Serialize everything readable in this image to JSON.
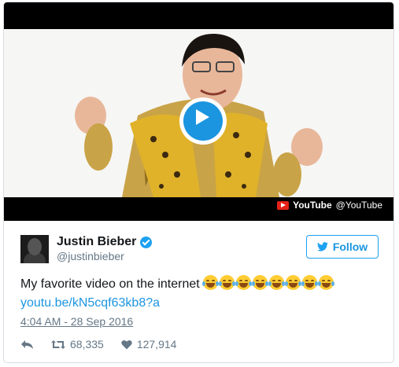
{
  "media": {
    "source_name": "YouTube",
    "source_handle": "@YouTube",
    "play_icon": "play-icon"
  },
  "user": {
    "name": "Justin Bieber",
    "screen_name": "@justinbieber",
    "verified_icon": "verified-icon"
  },
  "follow": {
    "label": "Follow",
    "icon": "twitter-bird-icon"
  },
  "tweet": {
    "text": "My favorite video on the internet",
    "emoji_name": "face-with-tears-of-joy",
    "emoji_count": 8,
    "link": "youtu.be/kN5cqf63kb8?a",
    "timestamp": "4:04 AM - 28 Sep 2016"
  },
  "actions": {
    "reply_icon": "reply-icon",
    "retweet_icon": "retweet-icon",
    "retweets": "68,335",
    "like_icon": "heart-icon",
    "likes": "127,914"
  },
  "colors": {
    "accent": "#1da1f2",
    "link": "#1b95e0",
    "muted": "#657786",
    "youtube_red": "#e62117"
  }
}
